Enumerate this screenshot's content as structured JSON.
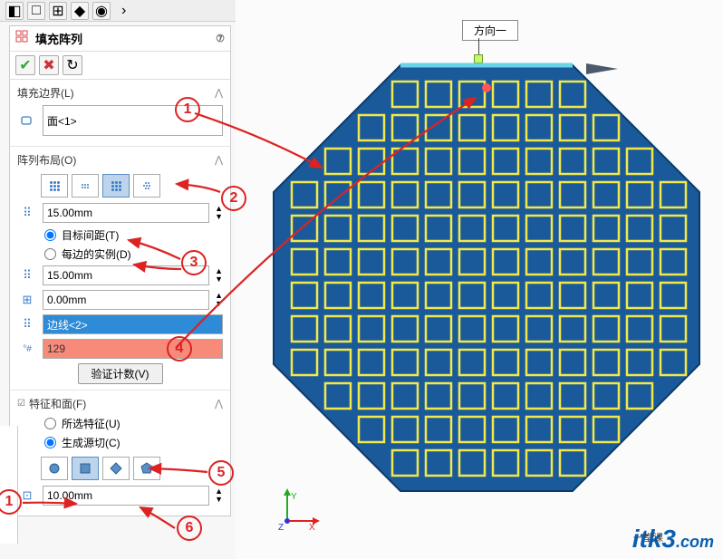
{
  "title": "填充阵列",
  "boundary": {
    "label": "填充边界(L)",
    "value": "面<1>"
  },
  "layout": {
    "label": "阵列布局(O)",
    "spacing1": "15.00mm",
    "radio_target": "目标间距(T)",
    "radio_instances": "每边的实例(D)",
    "spacing2": "15.00mm",
    "margin": "0.00mm",
    "direction": "边线<2>",
    "count": "129",
    "verify": "验证计数(V)"
  },
  "features": {
    "label": "特征和面(F)",
    "radio_selected": "所选特征(U)",
    "radio_source": "生成源切(C)",
    "size": "10.00mm"
  },
  "viewport": {
    "direction_label": "方向一"
  },
  "watermark": {
    "brand": "itk3",
    "domain": ".com",
    "tagline": "一堂课"
  },
  "annotations": [
    "1",
    "2",
    "3",
    "4",
    "5",
    "6",
    "1"
  ]
}
